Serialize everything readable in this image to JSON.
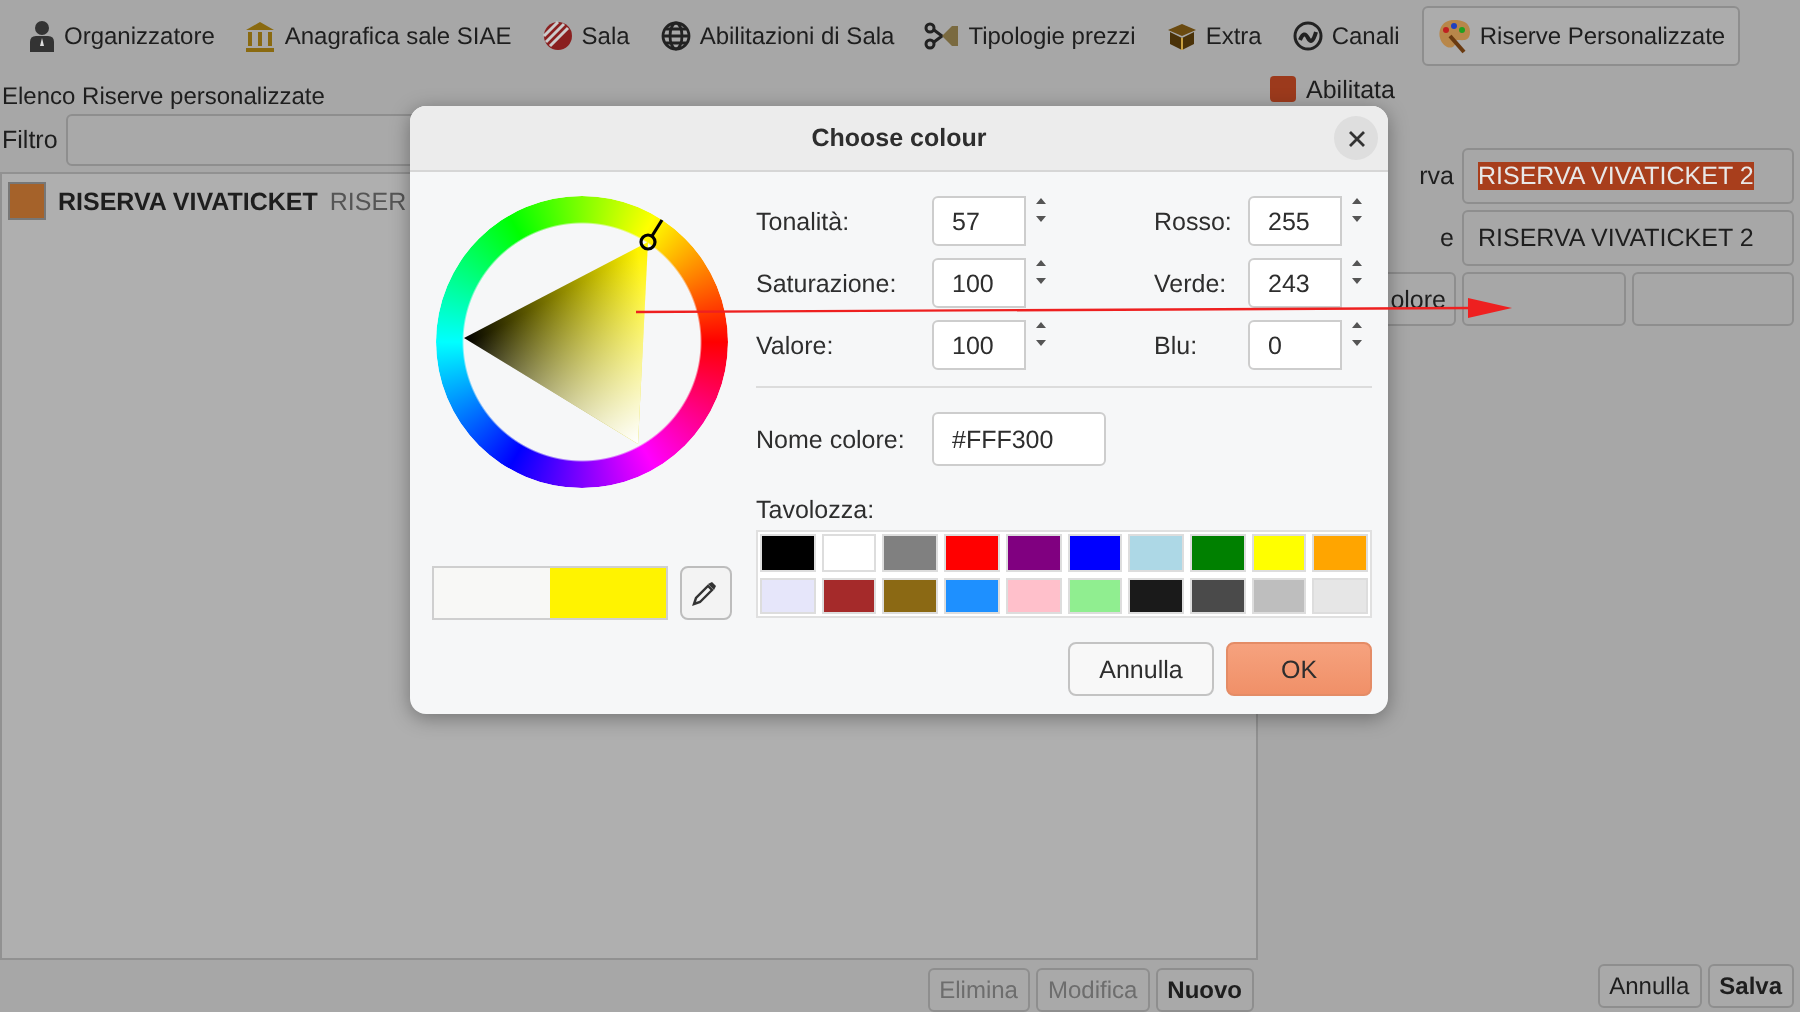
{
  "toolbar": [
    {
      "label": "Organizzatore",
      "selected": false
    },
    {
      "label": "Anagrafica sale SIAE",
      "selected": false
    },
    {
      "label": "Sala",
      "selected": false
    },
    {
      "label": "Abilitazioni di Sala",
      "selected": false
    },
    {
      "label": "Tipologie prezzi",
      "selected": false
    },
    {
      "label": "Extra",
      "selected": false
    },
    {
      "label": "Canali",
      "selected": false
    },
    {
      "label": "Riserve Personalizzate",
      "selected": true
    }
  ],
  "list_panel": {
    "title": "Elenco Riserve personalizzate",
    "filter_label": "Filtro",
    "rows": [
      {
        "name": "RISERVA VIVATICKET",
        "description": "RISER",
        "color": "#a5622a"
      }
    ],
    "buttons": [
      {
        "label": "Elimina",
        "disabled": true
      },
      {
        "label": "Modifica",
        "disabled": true
      },
      {
        "label": "Nuovo",
        "disabled": false
      }
    ]
  },
  "detail_panel": {
    "enabled": {
      "label": "Abilitata",
      "checked": true
    },
    "fields": [
      {
        "label": "rva",
        "value": "RISERVA VIVATICKET 2",
        "selected": true
      },
      {
        "label": "e",
        "value": "RISERVA VIVATICKET 2",
        "selected": false
      }
    ],
    "color_button": "olore",
    "buttons": [
      {
        "label": "Annulla"
      },
      {
        "label": "Salva"
      }
    ]
  },
  "dialog": {
    "title": "Choose colour",
    "hsv": [
      {
        "label": "Tonalità:",
        "value": "57"
      },
      {
        "label": "Saturazione:",
        "value": "100"
      },
      {
        "label": "Valore:",
        "value": "100"
      }
    ],
    "rgb": [
      {
        "label": "Rosso:",
        "value": "255"
      },
      {
        "label": "Verde:",
        "value": "243"
      },
      {
        "label": "Blu:",
        "value": "0"
      }
    ],
    "name_label": "Nome colore:",
    "name_value": "#FFF300",
    "preview": [
      {
        "color": "#f8f8f6"
      },
      {
        "color": "#fff300"
      }
    ],
    "palette_label": "Tavolozza:",
    "palette": [
      {
        "color": "#000000"
      },
      {
        "color": "#ffffff"
      },
      {
        "color": "#808080"
      },
      {
        "color": "#ff0000"
      },
      {
        "color": "#800080"
      },
      {
        "color": "#0000ff"
      },
      {
        "color": "#add8e6"
      },
      {
        "color": "#008000"
      },
      {
        "color": "#ffff00"
      },
      {
        "color": "#ffa500"
      },
      {
        "color": "#e6e6fa"
      },
      {
        "color": "#a52a2a"
      },
      {
        "color": "#8b6914"
      },
      {
        "color": "#1e90ff"
      },
      {
        "color": "#ffc0cb"
      },
      {
        "color": "#90ee90"
      },
      {
        "color": "#1a1a1a"
      },
      {
        "color": "#4a4a4a"
      },
      {
        "color": "#bebebe"
      },
      {
        "color": "#e6e6e6"
      }
    ],
    "buttons": [
      {
        "label": "Annulla",
        "kind": "normal"
      },
      {
        "label": "OK",
        "kind": "suggested"
      }
    ]
  }
}
